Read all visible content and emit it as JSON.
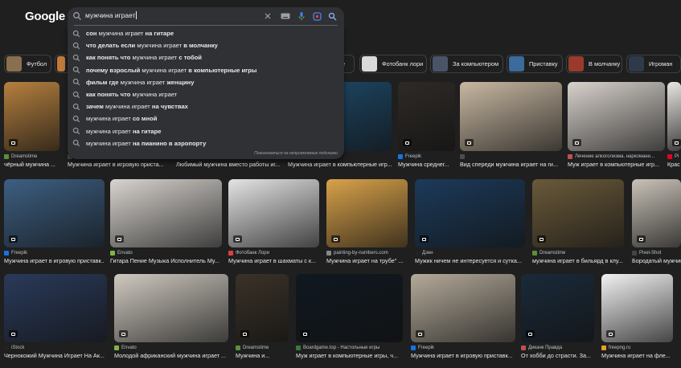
{
  "logo": "Google",
  "search": {
    "query": "мужчина играет",
    "footer": "Пожаловаться на неприемлемые подсказки"
  },
  "suggestions": [
    {
      "pre": "",
      "bold1": "сон",
      "mid": " мужчина играет ",
      "bold2": "на гитаре"
    },
    {
      "pre": "",
      "bold1": "что делать если",
      "mid": " мужчина играет ",
      "bold2": "в молчанку"
    },
    {
      "pre": "",
      "bold1": "как понять что",
      "mid": " мужчина играет ",
      "bold2": "с тобой"
    },
    {
      "pre": "",
      "bold1": "почему взрослый",
      "mid": " мужчина играет ",
      "bold2": "в компьютерные игры"
    },
    {
      "pre": "",
      "bold1": "фильм где",
      "mid": " мужчина играет ",
      "bold2": "женщину"
    },
    {
      "pre": "",
      "bold1": "как понять что",
      "mid": " мужчина играет",
      "bold2": ""
    },
    {
      "pre": "",
      "bold1": "зачем",
      "mid": " мужчина играет ",
      "bold2": "на чувствах"
    },
    {
      "pre": "",
      "bold1": "",
      "mid": "мужчина играет ",
      "bold2": "со мной"
    },
    {
      "pre": "",
      "bold1": "",
      "mid": "мужчина играет ",
      "bold2": "на гитаре"
    },
    {
      "pre": "",
      "bold1": "",
      "mid": "мужчина играет ",
      "bold2": "на пианино в аэропорту"
    }
  ],
  "chips": [
    {
      "label": "Футбол",
      "color": "#8a6f4e"
    },
    {
      "label": "",
      "color": "#c07a3a"
    },
    {
      "label": "ре",
      "color": "#2a2a2a"
    },
    {
      "label": "Фотобанк лори",
      "color": "#d9d9d9"
    },
    {
      "label": "За компьютером",
      "color": "#4a5468"
    },
    {
      "label": "Приставку",
      "color": "#3a6b9a"
    },
    {
      "label": "В молчанку",
      "color": "#9a3a2a"
    },
    {
      "label": "Игроман",
      "color": "#2e3a4a"
    }
  ],
  "row1": [
    {
      "source": "Dreamstime",
      "title": "чёрный мужчина ...",
      "fav": "#5b8f3a",
      "img": "#b5803f"
    },
    {
      "source": "",
      "title": "Мужчина играет в игровую приста...",
      "fav": "#4d4d4d",
      "img": "#3a3a3a"
    },
    {
      "source": "",
      "title": "Любимый мужчина вместо работы иг...",
      "fav": "#4d4d4d",
      "img": "#3a3a3a"
    },
    {
      "source": "",
      "title": "Мужчина играет в компьютерные игр...",
      "fav": "#4d4d4d",
      "img": "#1d4a6a"
    },
    {
      "source": "Freepik",
      "title": "Мужчина среднег...",
      "fav": "#1473e6",
      "img": "#2e2a26"
    },
    {
      "source": "",
      "title": "Вид спереди мужчина играет на ги...",
      "fav": "#4d4d4d",
      "img": "#c8b8a2"
    },
    {
      "source": "Лечение алкоголизма, наркомани...",
      "title": "Муж играет в компьютерные игр...",
      "fav": "#c0504d",
      "img": "#d8d2cc"
    },
    {
      "source": "Pi",
      "title": "Крас",
      "fav": "#e60023",
      "img": "#e9e6e2"
    }
  ],
  "row2": [
    {
      "source": "Freepik",
      "title": "Мужчина играет в игровую приставк...",
      "fav": "#1473e6",
      "img": "#3d5f82"
    },
    {
      "source": "Envato",
      "title": "Гитара Пение Музыка Исполнитель Му...",
      "fav": "#82b541",
      "img": "#d8d4cf"
    },
    {
      "source": "Фотобанк Лори",
      "title": "Мужчина играет в шахматы с к...",
      "fav": "#e04040",
      "img": "#e4e4e4"
    },
    {
      "source": "painting-by-numbers.com",
      "title": "Мужчина играет на трубе\" ...",
      "fav": "#888888",
      "img": "#d9a24a"
    },
    {
      "source": "Дзен",
      "title": "Мужик ничем не интересуется и сутка...",
      "fav": "#222222",
      "img": "#1c3a5a"
    },
    {
      "source": "Dreamstime",
      "title": "мужчина играет в бильярд в клу...",
      "fav": "#5b8f3a",
      "img": "#6a5a3a"
    },
    {
      "source": "Pixel-Shot",
      "title": "Бородатый мужчина ...",
      "fav": "#444444",
      "img": "#c9c2b8"
    }
  ],
  "row3": [
    {
      "source": "iStock",
      "title": "Чернокожий Мужчина Играет На Ак...",
      "fav": "#222222",
      "img": "#2a3a5a"
    },
    {
      "source": "Envato",
      "title": "Молодой африканский мужчина играет ...",
      "fav": "#82b541",
      "img": "#cfc9c0"
    },
    {
      "source": "Dreamstime",
      "title": "Мужчина и...",
      "fav": "#5b8f3a",
      "img": "#3a3228"
    },
    {
      "source": "Boardgame.top - Настольные игры",
      "title": "Муж играет в компьютерные игры, ч...",
      "fav": "#3a7a3a",
      "img": "#101820"
    },
    {
      "source": "Freepik",
      "title": "Мужчина играет в игровую приставк...",
      "fav": "#1473e6",
      "img": "#b4aa9a"
    },
    {
      "source": "Диканк Правда",
      "title": "От хобби до страсти. За...",
      "fav": "#c0504d",
      "img": "#1a2a3a"
    },
    {
      "source": "freepng.ru",
      "title": "Мужчина играет на фле...",
      "fav": "#e0a030",
      "img": "#f2f2f2"
    }
  ]
}
